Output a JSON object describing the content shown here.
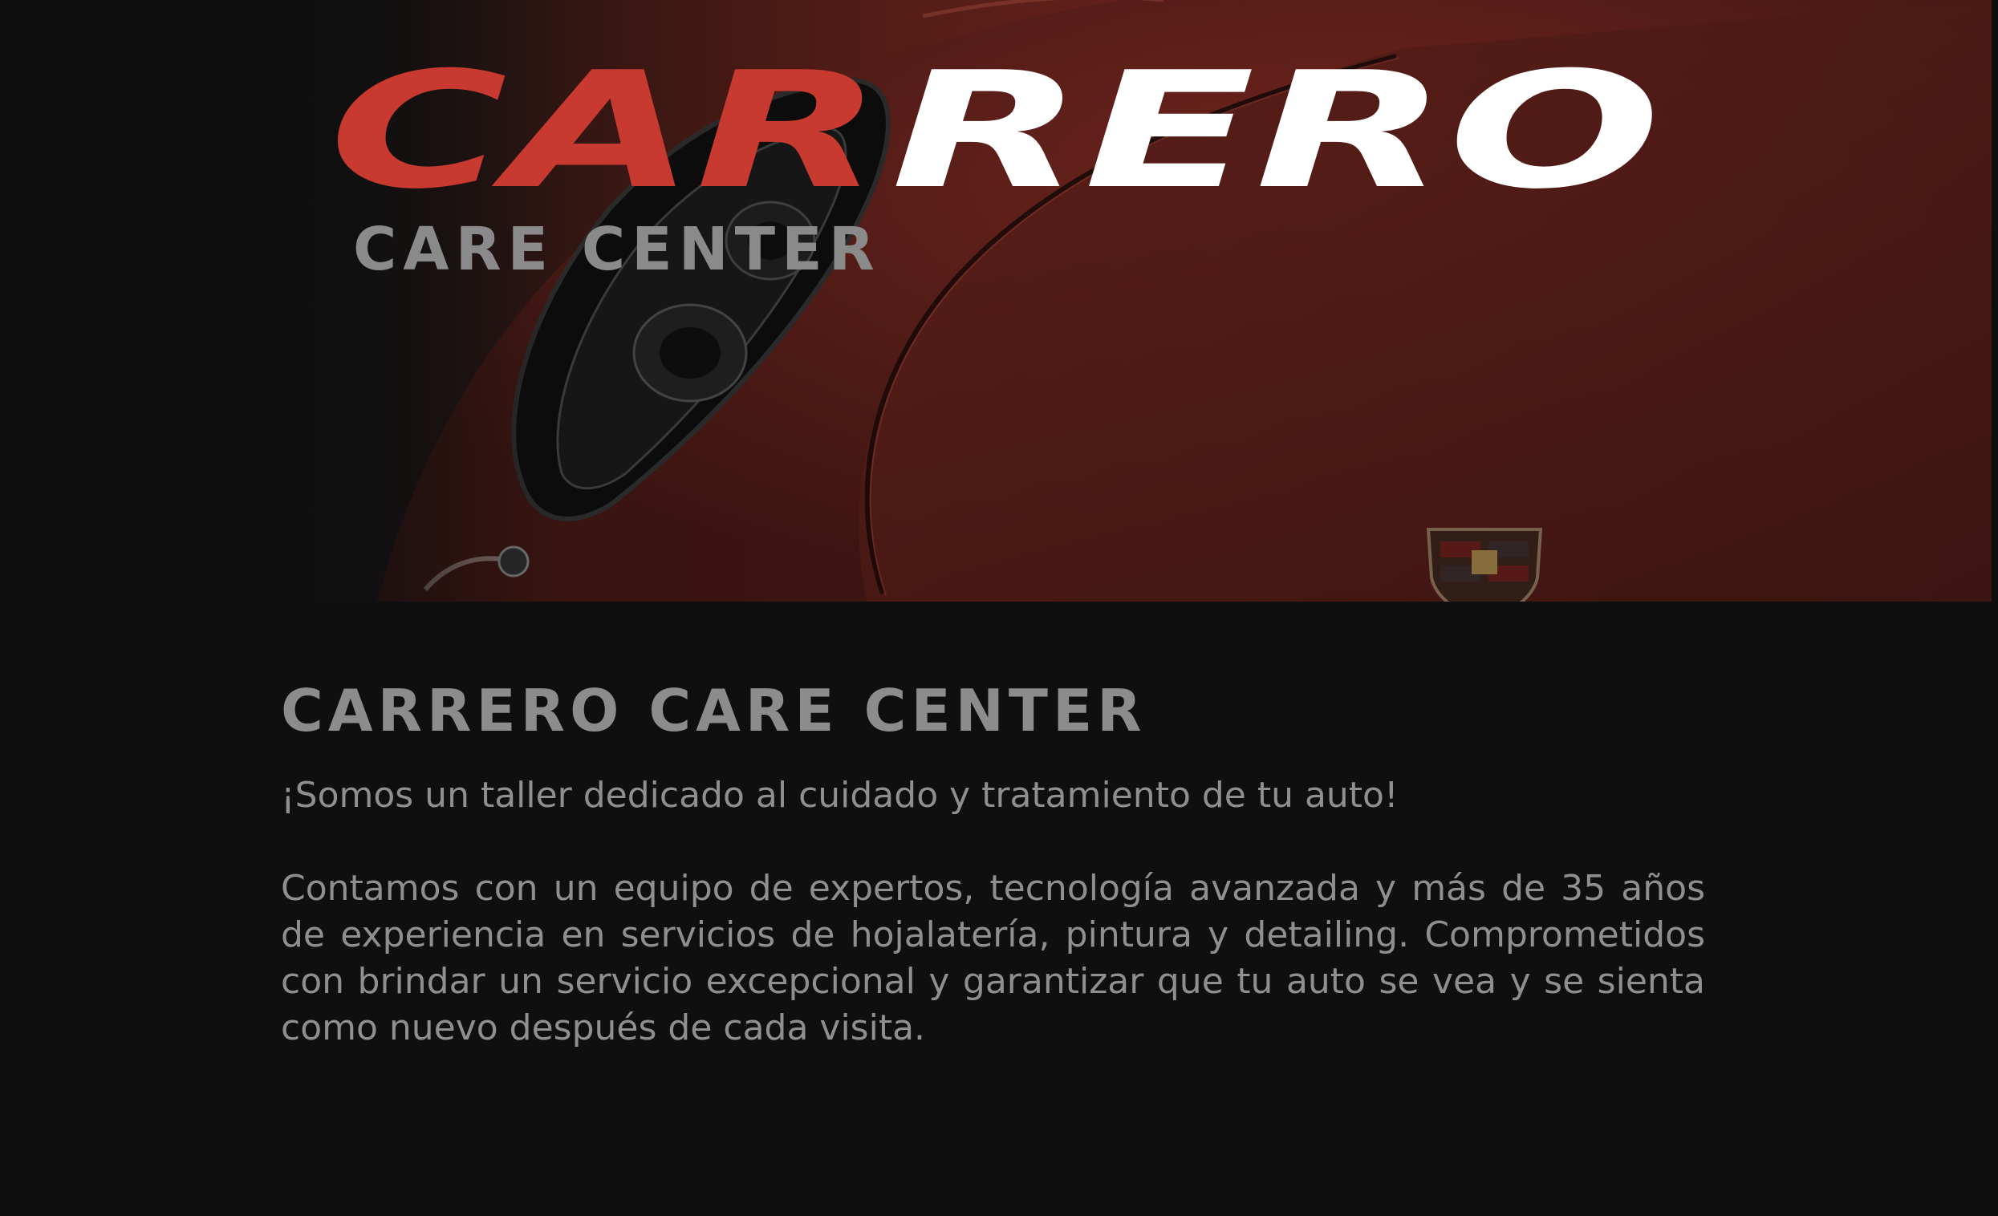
{
  "hero": {
    "logo": {
      "brand_red_part": "CAR",
      "brand_white_part": "RERO",
      "tagline": "CARE CENTER",
      "colors": {
        "red": "#c8392f",
        "white": "#ffffff",
        "tagline": "#8a8a8a"
      }
    },
    "background_image": "red-sports-car-headlight-closeup"
  },
  "about": {
    "title": "CARRERO CARE CENTER",
    "intro": "¡Somos un taller dedicado al cuidado y tratamiento de tu auto!",
    "body": "Contamos con un equipo de expertos, tecnología avanzada y más de 35 años de experiencia en servicios de hojalatería, pintura y detailing. Comprometidos con brindar un servicio excepcional y garantizar que tu auto se vea y se sienta como nuevo después de cada visita."
  },
  "colors": {
    "page_background": "#0f0f0f",
    "text_gray": "#8f8f8f"
  }
}
